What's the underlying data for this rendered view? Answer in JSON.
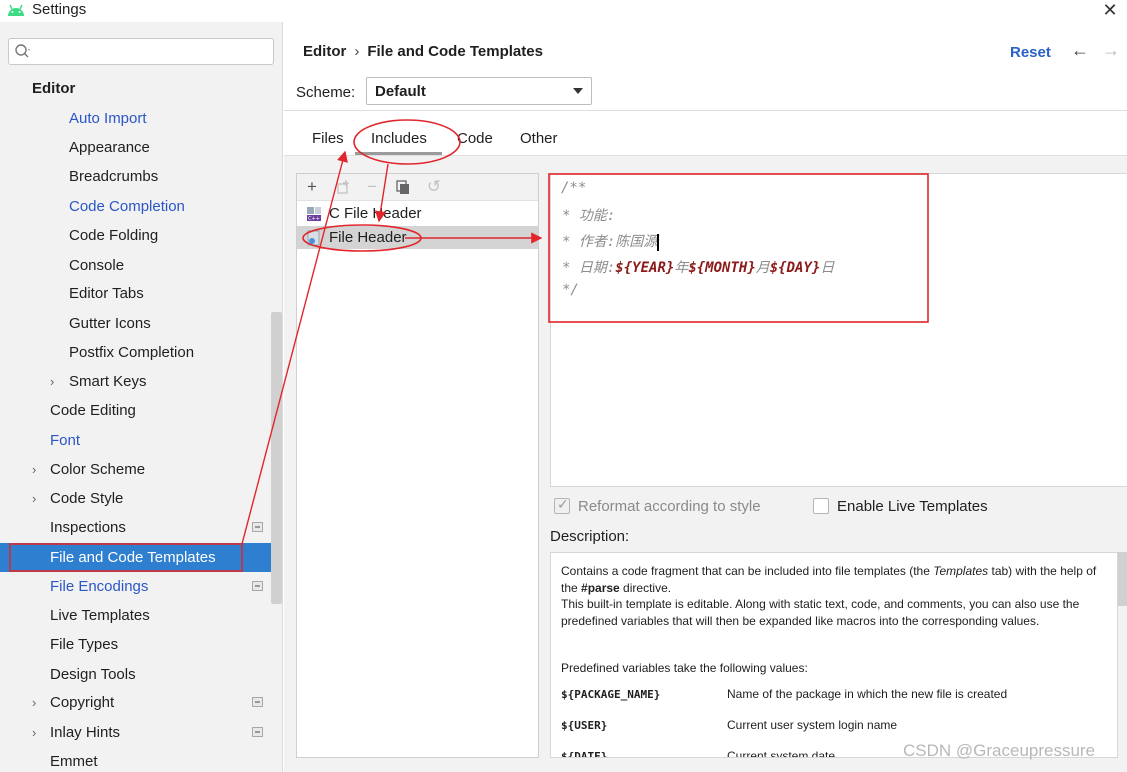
{
  "window": {
    "title": "Settings"
  },
  "search": {
    "placeholder": ""
  },
  "sidebar": {
    "items": [
      {
        "label": "Editor"
      },
      {
        "label": "Auto Import"
      },
      {
        "label": "Appearance"
      },
      {
        "label": "Breadcrumbs"
      },
      {
        "label": "Code Completion"
      },
      {
        "label": "Code Folding"
      },
      {
        "label": "Console"
      },
      {
        "label": "Editor Tabs"
      },
      {
        "label": "Gutter Icons"
      },
      {
        "label": "Postfix Completion"
      },
      {
        "label": "Smart Keys"
      },
      {
        "label": "Code Editing"
      },
      {
        "label": "Font"
      },
      {
        "label": "Color Scheme"
      },
      {
        "label": "Code Style"
      },
      {
        "label": "Inspections"
      },
      {
        "label": "File and Code Templates"
      },
      {
        "label": "File Encodings"
      },
      {
        "label": "Live Templates"
      },
      {
        "label": "File Types"
      },
      {
        "label": "Design Tools"
      },
      {
        "label": "Copyright"
      },
      {
        "label": "Inlay Hints"
      },
      {
        "label": "Emmet"
      }
    ]
  },
  "header": {
    "breadcrumb_parent": "Editor",
    "breadcrumb_sep": "›",
    "breadcrumb_current": "File and Code Templates",
    "reset_label": "Reset",
    "back_glyph": "←",
    "forward_glyph": "→"
  },
  "scheme": {
    "label": "Scheme:",
    "value": "Default"
  },
  "tabs": [
    {
      "label": "Files"
    },
    {
      "label": "Includes"
    },
    {
      "label": "Code"
    },
    {
      "label": "Other"
    }
  ],
  "toolbar": {
    "add": "+",
    "remove": "−",
    "reset": "↺"
  },
  "templates": [
    {
      "label": "C File Header"
    },
    {
      "label": "File Header"
    }
  ],
  "editor": {
    "line1": "/**",
    "line2": "* 功能:",
    "line3": "* 作者:陈国源",
    "line4_prefix": "* 日期:",
    "line4_year": "${YEAR}",
    "line4_year_suffix": "年",
    "line4_month": "${MONTH}",
    "line4_month_suffix": "月",
    "line4_day": "${DAY}",
    "line4_day_suffix": "日",
    "line5": "*/"
  },
  "options": {
    "reformat_label": "Reformat according to style",
    "live_templates_label": "Enable Live Templates"
  },
  "description": {
    "label": "Description:",
    "p1_a": "Contains a code fragment that can be included into file templates (the ",
    "p1_b": "Templates",
    "p1_c": " tab) with the help of the ",
    "p1_d": "#parse",
    "p1_e": " directive.",
    "p2": "This built-in template is editable. Along with static text, code, and comments, you can also use the predefined variables that will then be expanded like macros into the corresponding values.",
    "p3": "Predefined variables take the following values:",
    "vars": [
      {
        "name": "${PACKAGE_NAME}",
        "desc": "Name of the package in which the new file is created"
      },
      {
        "name": "${USER}",
        "desc": "Current user system login name"
      },
      {
        "name": "${DATE}",
        "desc": "Current system date"
      }
    ]
  },
  "watermark": "CSDN @Graceupressure",
  "colors": {
    "accent": "#2f7fd0",
    "link": "#2a56c6",
    "annotation": "#e0262c",
    "template_var": "#8b1a1a"
  }
}
